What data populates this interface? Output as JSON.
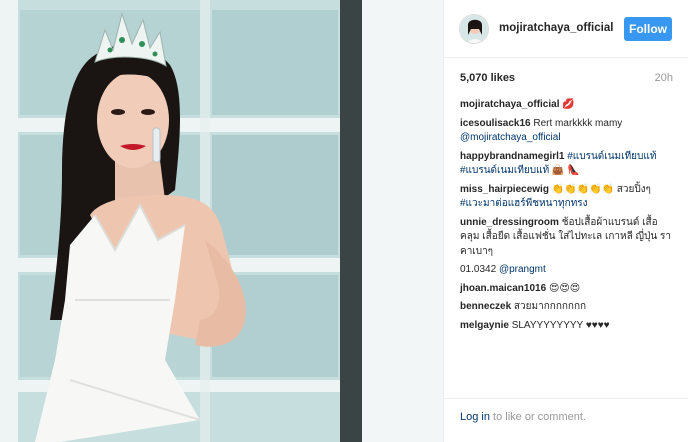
{
  "post": {
    "username": "mojiratchaya_official",
    "follow_label": "Follow",
    "likes": "5,070 likes",
    "time": "20h"
  },
  "comments": [
    {
      "author": "mojiratchaya_official",
      "text": "💋"
    },
    {
      "author": "icesoulisack16",
      "text": "Rert markkkk mamy ",
      "mention": "@mojiratchaya_official"
    },
    {
      "author": "happybrandnamegirl1",
      "text": "",
      "mention": "#แบรนด์เนมเทียบแท้ #แบรนด์เนมเทียบแท้",
      "tail": " 👜 👠"
    },
    {
      "author": "miss_hairpiecewig",
      "text": "👏👏👏👏👏 สวยปิ้งๆ ",
      "mention": "#แวะมาต่อแฮร์พีชหนาทุกทรง"
    },
    {
      "author": "unnie_dressingroom",
      "text": "ช้อปเสื้อผ้าแบรนด์ เสื้อคลุม เสื้อยืด เสื้อแฟชั่น ใส่ไปทะเล เกาหลี ญี่ปุ่น ราคาเบาๆ"
    },
    {
      "author": "01.0342",
      "author_style": "light",
      "text": "",
      "mention": "@prangmt"
    },
    {
      "author": "jhoan.maican1016",
      "text": "😍😍😍"
    },
    {
      "author": "benneczek",
      "text": "สวยมากกกกกกก"
    },
    {
      "author": "melgaynie",
      "text": "SLAYYYYYYYY ♥♥♥♥"
    }
  ],
  "footer": {
    "login_link": "Log in",
    "login_rest": " to like or comment."
  },
  "colors": {
    "follow_button": "#3897f0",
    "link": "#003569",
    "muted": "#999999"
  }
}
